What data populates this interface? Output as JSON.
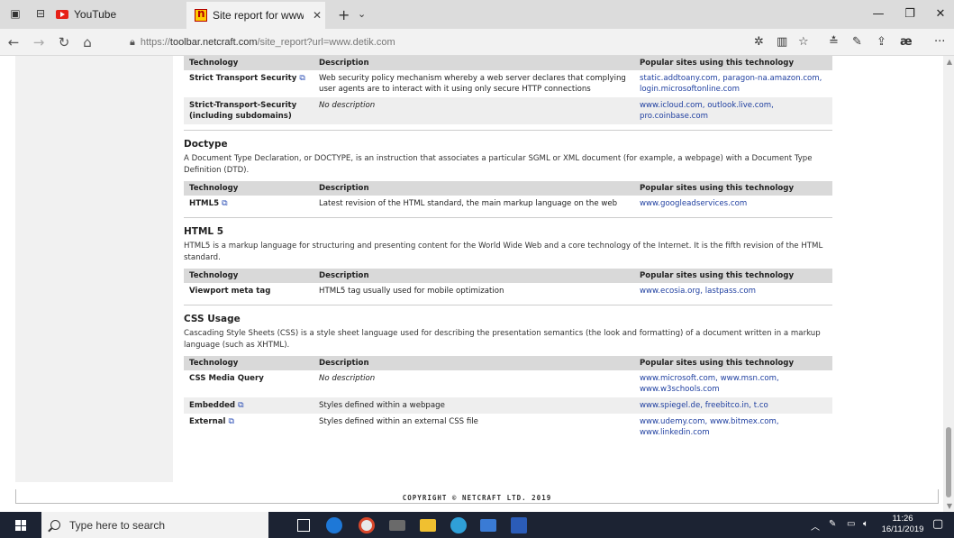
{
  "browser": {
    "tabs": [
      {
        "label": "YouTube"
      },
      {
        "label": "Site report for www.deti"
      }
    ],
    "url_prefix": "https://",
    "url_host": "toolbar.netcraft.com",
    "url_path": "/site_report?url=www.detik.com"
  },
  "page": {
    "top_table": {
      "headers": [
        "Technology",
        "Description",
        "Popular sites using this technology"
      ],
      "rows": [
        {
          "name": "Strict Transport Security",
          "desc": "Web security policy mechanism whereby a web server declares that complying user agents are to interact with it using only secure HTTP connections",
          "sites": "static.addtoany.com, paragon-na.amazon.com, login.microsoftonline.com"
        },
        {
          "name": "Strict-Transport-Security (including subdomains)",
          "desc": "No description",
          "sites": "www.icloud.com, outlook.live.com, pro.coinbase.com"
        }
      ]
    },
    "doctype": {
      "title": "Doctype",
      "desc": "A Document Type Declaration, or DOCTYPE, is an instruction that associates a particular SGML or XML document (for example, a webpage) with a Document Type Definition (DTD).",
      "headers": [
        "Technology",
        "Description",
        "Popular sites using this technology"
      ],
      "rows": [
        {
          "name": "HTML5",
          "desc": "Latest revision of the HTML standard, the main markup language on the web",
          "sites": "www.googleadservices.com"
        }
      ]
    },
    "html5": {
      "title": "HTML 5",
      "desc": "HTML5 is a markup language for structuring and presenting content for the World Wide Web and a core technology of the Internet. It is the fifth revision of the HTML standard.",
      "headers": [
        "Technology",
        "Description",
        "Popular sites using this technology"
      ],
      "rows": [
        {
          "name": "Viewport meta tag",
          "desc": "HTML5 tag usually used for mobile optimization",
          "sites": "www.ecosia.org, lastpass.com"
        }
      ]
    },
    "css": {
      "title": "CSS Usage",
      "desc": "Cascading Style Sheets (CSS) is a style sheet language used for describing the presentation semantics (the look and formatting) of a document written in a markup language (such as XHTML).",
      "headers": [
        "Technology",
        "Description",
        "Popular sites using this technology"
      ],
      "rows": [
        {
          "name": "CSS Media Query",
          "desc": "No description",
          "sites": "www.microsoft.com, www.msn.com, www.w3schools.com"
        },
        {
          "name": "Embedded",
          "desc": "Styles defined within a webpage",
          "sites": "www.spiegel.de, freebitco.in, t.co"
        },
        {
          "name": "External",
          "desc": "Styles defined within an external CSS file",
          "sites": "www.udemy.com, www.bitmex.com, www.linkedin.com"
        }
      ]
    },
    "copyright": "COPYRIGHT © NETCRAFT LTD. 2019"
  },
  "taskbar": {
    "search_placeholder": "Type here to search",
    "time": "11:26",
    "date": "16/11/2019"
  },
  "colors": {
    "link": "#1f3fa0",
    "header_bg": "#d9d9d9",
    "taskbar": "#1c2333"
  }
}
